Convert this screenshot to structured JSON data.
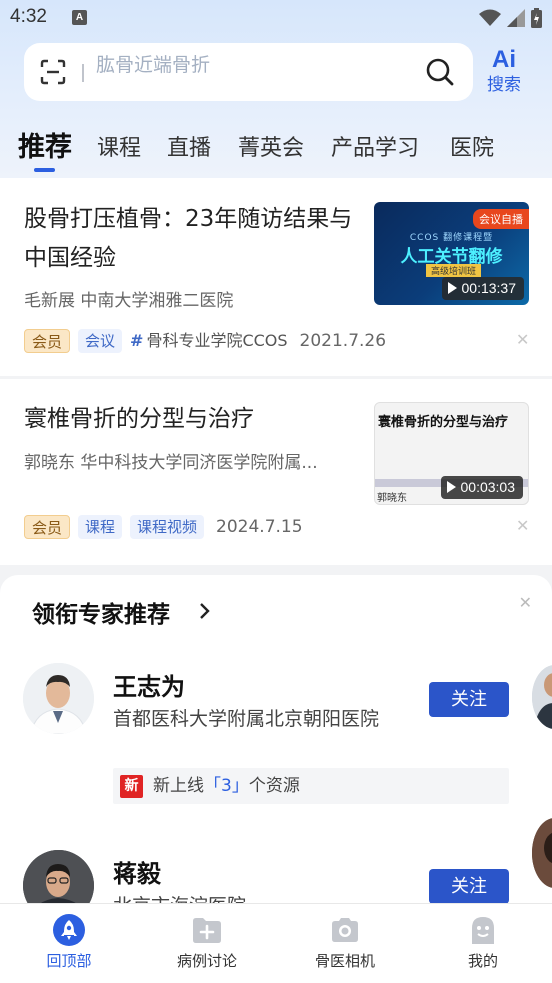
{
  "status_bar": {
    "time": "4:32",
    "notification_letter": "A"
  },
  "search": {
    "placeholder": "肱骨近端骨折",
    "ai_glyph": "Ai",
    "ai_label": "搜索"
  },
  "tabs": [
    {
      "label": "推荐",
      "active": true
    },
    {
      "label": "课程"
    },
    {
      "label": "直播"
    },
    {
      "label": "菁英会"
    },
    {
      "label": "产品学习"
    },
    {
      "label": "医院"
    }
  ],
  "feed": [
    {
      "title": "股骨打压植骨：23年随访结果与中国经验",
      "author": "毛新展  中南大学湘雅二医院",
      "duration": "00:13:37",
      "thumb_badge": "会议自播",
      "thumb_line1": "CCOS 翻修课程暨",
      "thumb_title": "人工关节翻修",
      "thumb_subtitle": "高级培训班",
      "tags": [
        "会员",
        "会议"
      ],
      "hashtag": "骨科专业学院CCOS",
      "date": "2021.7.26"
    },
    {
      "title": "寰椎骨折的分型与治疗",
      "author": "郭晓东  华中科技大学同济医学院附属...",
      "duration": "00:03:03",
      "thumb_title": "寰椎骨折的分型与治疗",
      "thumb_author": "郭晓东",
      "tags": [
        "会员",
        "课程",
        "课程视频"
      ],
      "date": "2024.7.15"
    }
  ],
  "experts": {
    "title": "领衔专家推荐",
    "items": [
      {
        "name": "王志为",
        "org": "首都医科大学附属北京朝阳医院",
        "follow_label": "关注",
        "new_badge": "新",
        "new_prefix": "新上线",
        "new_count": "「3」",
        "new_suffix": "个资源"
      },
      {
        "name": "蒋毅",
        "org": "北京市海淀医院",
        "follow_label": "关注"
      }
    ]
  },
  "bottom_nav": [
    {
      "label": "回顶部",
      "icon": "rocket-icon",
      "active": true
    },
    {
      "label": "病例讨论",
      "icon": "folder-plus-icon"
    },
    {
      "label": "骨医相机",
      "icon": "camera-icon"
    },
    {
      "label": "我的",
      "icon": "profile-icon"
    }
  ],
  "colors": {
    "accent": "#2c5fe0",
    "follow_button": "#2b55c9",
    "member_tag": "#fbe7c6",
    "new_badge": "#e02424"
  }
}
